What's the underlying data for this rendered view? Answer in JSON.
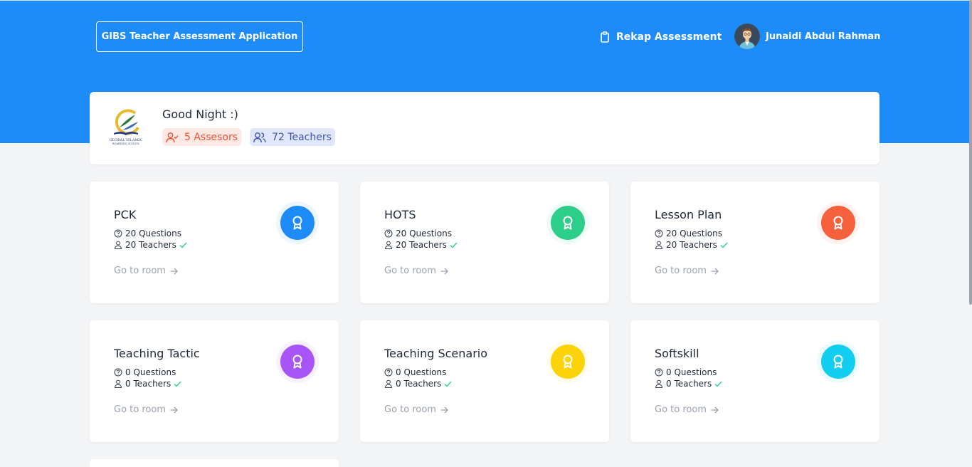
{
  "header": {
    "app_title": "GIBS Teacher Assessment Application",
    "rekap_label": "Rekap Assessment",
    "rekap_icon": "clipboard-icon",
    "user_name": "Junaidi Abdul Rahman"
  },
  "greeting": {
    "title": "Good Night :)",
    "logo_text": "GLOBAL ISLAMIC BOARDING SCHOOL",
    "assessors": "5 Assesors",
    "teachers": "72 Teachers"
  },
  "colors": {
    "header_bg": "#1d8cf8",
    "pck": "#1d8cf8",
    "hots": "#2dce89",
    "lesson_plan": "#f5603d",
    "teaching_tactic": "#a855f7",
    "teaching_scenario": "#fcd307",
    "softskill": "#11cdef"
  },
  "cards": [
    {
      "title": "PCK",
      "questions": "20 Questions",
      "teachers": "20 Teachers",
      "link": "Go to room",
      "icon": "award-icon"
    },
    {
      "title": "HOTS",
      "questions": "20 Questions",
      "teachers": "20 Teachers",
      "link": "Go to room",
      "icon": "award-icon"
    },
    {
      "title": "Lesson Plan",
      "questions": "20 Questions",
      "teachers": "20 Teachers",
      "link": "Go to room",
      "icon": "award-icon"
    },
    {
      "title": "Teaching Tactic",
      "questions": "0 Questions",
      "teachers": "0 Teachers",
      "link": "Go to room",
      "icon": "award-icon"
    },
    {
      "title": "Teaching Scenario",
      "questions": "0 Questions",
      "teachers": "0 Teachers",
      "link": "Go to room",
      "icon": "award-icon"
    },
    {
      "title": "Softskill",
      "questions": "0 Questions",
      "teachers": "0 Teachers",
      "link": "Go to room",
      "icon": "award-icon"
    }
  ]
}
